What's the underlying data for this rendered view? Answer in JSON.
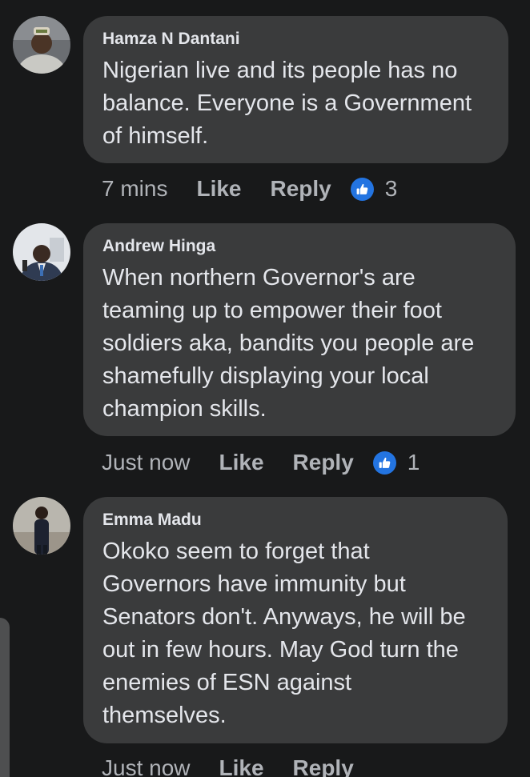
{
  "colors": {
    "background": "#18191a",
    "bubble": "#3a3b3c",
    "text": "#e4e6eb",
    "muted": "#b0b3b8",
    "like_badge": "#2374e1"
  },
  "comments": [
    {
      "author": "Hamza N Dantani",
      "text": "Nigerian live and its people has no\nbalance. Everyone is a Government\nof himself.",
      "time": "7 mins",
      "like_label": "Like",
      "reply_label": "Reply",
      "reaction_icon": "thumbs-up-icon",
      "reaction_count": "3"
    },
    {
      "author": "Andrew Hinga",
      "text": "When northern Governor's are\nteaming up to empower their foot\nsoldiers aka, bandits you people are\nshamefully displaying your local\nchampion skills.",
      "time": "Just now",
      "like_label": "Like",
      "reply_label": "Reply",
      "reaction_icon": "thumbs-up-icon",
      "reaction_count": "1"
    },
    {
      "author": "Emma Madu",
      "text": "Okoko seem to forget that\nGovernors have immunity but\nSenators don't. Anyways, he will be\nout in few hours. May God turn the\nenemies of ESN against\nthemselves.",
      "time": "Just now",
      "like_label": "Like",
      "reply_label": "Reply"
    }
  ]
}
